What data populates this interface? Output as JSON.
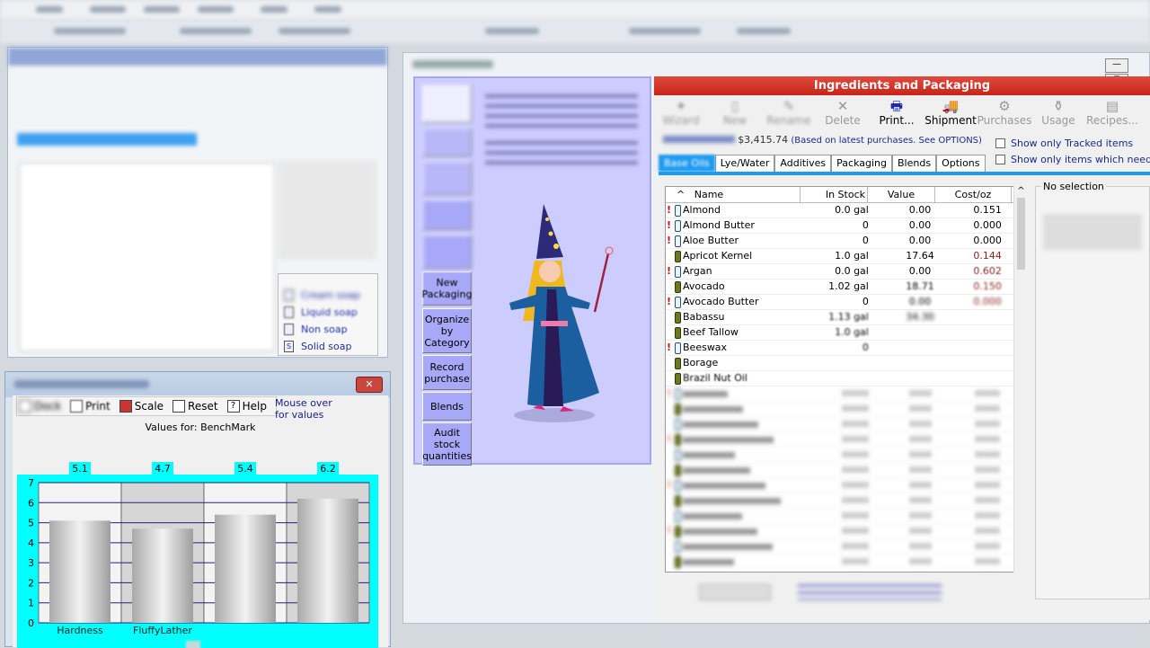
{
  "left_window": {
    "soap_types": [
      {
        "label": "Cream soap",
        "icon": "cream-soap-icon"
      },
      {
        "label": "Liquid soap",
        "icon": "liquid-soap-icon"
      },
      {
        "label": "Non soap",
        "icon": "non-soap-icon"
      },
      {
        "label": "Solid soap",
        "icon": "solid-soap-icon",
        "glyph": "S"
      }
    ]
  },
  "chart_window": {
    "close_glyph": "✕",
    "tools": {
      "dock": "Dock",
      "print": "Print",
      "scale": "Scale",
      "reset": "Reset",
      "help": "Help"
    },
    "mouse_over": "Mouse over for values",
    "values_for": "Values for:  BenchMark",
    "frame_color": "#00ffff"
  },
  "chart_data": {
    "type": "bar",
    "categories": [
      "Hardness",
      "FluffyLather",
      "",
      ""
    ],
    "values": [
      5.1,
      4.7,
      5.4,
      6.2
    ],
    "data_labels": [
      "5.1",
      "4.7",
      "5.4",
      "6.2"
    ],
    "ylim": [
      0,
      7
    ],
    "yticks": [
      "0",
      "1",
      "2",
      "3",
      "4",
      "5",
      "6",
      "7"
    ],
    "grid": true,
    "legend": "bottom"
  },
  "wizard": {
    "buttons": [
      "New Packaging",
      "Organize by Category",
      "Record purchase",
      "Blends",
      "Audit stock quantities"
    ]
  },
  "ingredients": {
    "title": "Ingredients and Packaging",
    "accent": "#d02a1f",
    "toolbar": [
      {
        "label": "Wizard",
        "icon": "wizard-icon",
        "glyph": "✦",
        "enabled": false
      },
      {
        "label": "New",
        "icon": "new-icon",
        "glyph": "▯",
        "enabled": false
      },
      {
        "label": "Rename",
        "icon": "rename-icon",
        "glyph": "✎",
        "enabled": false
      },
      {
        "label": "Delete",
        "icon": "delete-icon",
        "glyph": "✕",
        "enabled": false
      },
      {
        "label": "Print...",
        "icon": "printer-icon",
        "glyph": "🖶",
        "enabled": true
      },
      {
        "label": "Shipment",
        "icon": "truck-icon",
        "glyph": "🚚",
        "enabled": true
      },
      {
        "label": "Purchases",
        "icon": "purchases-icon",
        "glyph": "⚙",
        "enabled": false
      },
      {
        "label": "Usage",
        "icon": "usage-icon",
        "glyph": "⚱",
        "enabled": false
      },
      {
        "label": "Recipes...",
        "icon": "recipes-icon",
        "glyph": "▤",
        "enabled": false
      }
    ],
    "stock_value": "$3,415.74",
    "stock_note": "(Based on latest purchases. See OPTIONS)",
    "show_tracked": "Show only Tracked items",
    "show_reorder": "Show only items which need rep",
    "tabs": [
      "Base Oils",
      "Lye/Water",
      "Additives",
      "Packaging",
      "Blends",
      "Options"
    ],
    "columns": [
      "Name",
      "In Stock",
      "Value",
      "Cost/oz"
    ],
    "sort_glyph": "^",
    "rows": [
      {
        "alert": "!",
        "full": false,
        "name": "Almond",
        "stock": "0.0 gal",
        "value": "0.00",
        "cost": "0.151"
      },
      {
        "alert": "!",
        "full": false,
        "name": "Almond Butter",
        "stock": "0",
        "value": "0.00",
        "cost": "0.000"
      },
      {
        "alert": "!",
        "full": false,
        "name": "Aloe Butter",
        "stock": "0",
        "value": "0.00",
        "cost": "0.000"
      },
      {
        "alert": "",
        "full": true,
        "name": "Apricot Kernel",
        "stock": "1.0 gal",
        "value": "17.64",
        "cost": "0.144"
      },
      {
        "alert": "!",
        "full": false,
        "name": "Argan",
        "stock": "0.0 gal",
        "value": "0.00",
        "cost": "0.602"
      },
      {
        "alert": "",
        "full": true,
        "name": "Avocado",
        "stock": "1.02 gal",
        "value": "18.71",
        "cost": "0.150"
      },
      {
        "alert": "!",
        "full": false,
        "name": "Avocado Butter",
        "stock": "0",
        "value": "0.00",
        "cost": "0.000"
      },
      {
        "alert": "",
        "full": true,
        "name": "Babassu",
        "stock": "1.13 gal",
        "value": "34.30",
        "cost": ""
      },
      {
        "alert": "",
        "full": true,
        "name": "Beef Tallow",
        "stock": "1.0 gal",
        "value": "",
        "cost": ""
      },
      {
        "alert": "!",
        "full": false,
        "name": "Beeswax",
        "stock": "0",
        "value": "",
        "cost": ""
      },
      {
        "alert": "",
        "full": true,
        "name": "Borage",
        "stock": "",
        "value": "",
        "cost": ""
      },
      {
        "alert": "",
        "full": true,
        "name": "Brazil Nut Oil",
        "stock": "",
        "value": "",
        "cost": ""
      }
    ],
    "no_selection": "No selection"
  }
}
